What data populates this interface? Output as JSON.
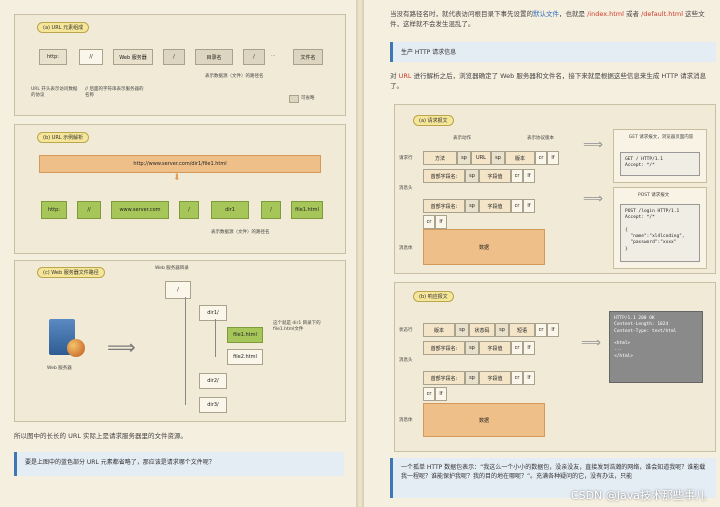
{
  "left": {
    "fig_a": {
      "title": "(a) URL 元素组成",
      "parts": [
        "http:",
        "//",
        "Web 服务器",
        "/",
        "目录名",
        "/",
        "…",
        "文件名"
      ],
      "dots": "·",
      "note_protocol": "URL 开头表示访问数据的协议",
      "note_server": "// 后面的字符串表示服务器的名称",
      "note_path": "表示数据源（文件）的路径名",
      "legend": "可省略"
    },
    "fig_b": {
      "title": "(b) URL 示例解析",
      "url": "http://www.server.com/dir1/file1.html",
      "parts": [
        "http:",
        "//",
        "www.server.com",
        "/",
        "dir1",
        "/",
        "file1.html"
      ],
      "note_path": "表示数据源（文件）的路径名"
    },
    "fig_c": {
      "title": "(c) Web 服务器文件路径",
      "root_label": "Web 服务器目录",
      "server_label": "Web 服务器",
      "nodes": [
        "/",
        "dir1/",
        "file1.html",
        "file2.html",
        "dir2/",
        "dir3/"
      ],
      "callout": "这个就是 dir1 目录下的 file1.html文件"
    },
    "caption": "所以图中的长长的 URL 实际上是请求服务器里的文件资源。",
    "note": "要是上图中的蓝色部分 URL 元素都省略了，那应该是请求哪个文件呢？"
  },
  "right": {
    "intro_1": "当没有路径名时，就代表访问根目录下事先设置的",
    "intro_hl": "默认文件",
    "intro_2": "，也就是",
    "intro_red1": "/index.html",
    "intro_3": "或者",
    "intro_red2": "/default.html",
    "intro_4": "这些文件，这样就不会发生混乱了。",
    "section": "生产 HTTP 请求信息",
    "para_1": "对",
    "para_red": "URL",
    "para_2": "进行解析之后，浏览器确定了 Web 服务器和文件名，接下来就是根据这些信息来生成 HTTP 请求消息了。",
    "req": {
      "title": "(a) 请求报文",
      "label_method": "表示动作",
      "label_ver": "表示协议版本",
      "row_label_line": "请求行",
      "row_label_head": "消息头",
      "row_label_body": "消息体",
      "line": [
        "方法",
        "sp",
        "URL",
        "sp",
        "版本",
        "cr",
        "lf"
      ],
      "head": [
        "首部字段名:",
        "sp",
        "字段值",
        "cr",
        "lf"
      ],
      "body": "数据",
      "get_title": "GET 请求报文，浏览器页面内容",
      "get_code": "GET / HTTP/1.1\nAccept: */*",
      "post_title": "POST 请求报文",
      "post_code": "POST /login HTTP/1.1\nAccept: */*\n\n{\n  \"name\":\"xl4lcoding\",\n  \"password\":\"xxxx\"\n}"
    },
    "resp": {
      "title": "(b) 响应报文",
      "row_label_line": "状态行",
      "row_label_head": "消息头",
      "row_label_body": "消息体",
      "line": [
        "版本",
        "sp",
        "状态码",
        "sp",
        "短语",
        "cr",
        "lf"
      ],
      "head": [
        "首部字段名:",
        "sp",
        "字段值",
        "cr",
        "lf"
      ],
      "body": "数据",
      "code": "HTTP/1.1 200 OK\nContent-Length: 1024\nContent-Type: text/html\n\n<html>\n...\n</html>"
    },
    "note": "一个孤单 HTTP 数据包表示：“我这么一个小小的数据包，没亲没友，直接发到浩瀚的网络，谁会知道我呢？谁能载我一程呢？谁能保护我呢？我的目的地在哪呢？”。充满各种疑问的它，没有办法，只能"
  },
  "watermark": "CSDN @Java技术那些事儿"
}
